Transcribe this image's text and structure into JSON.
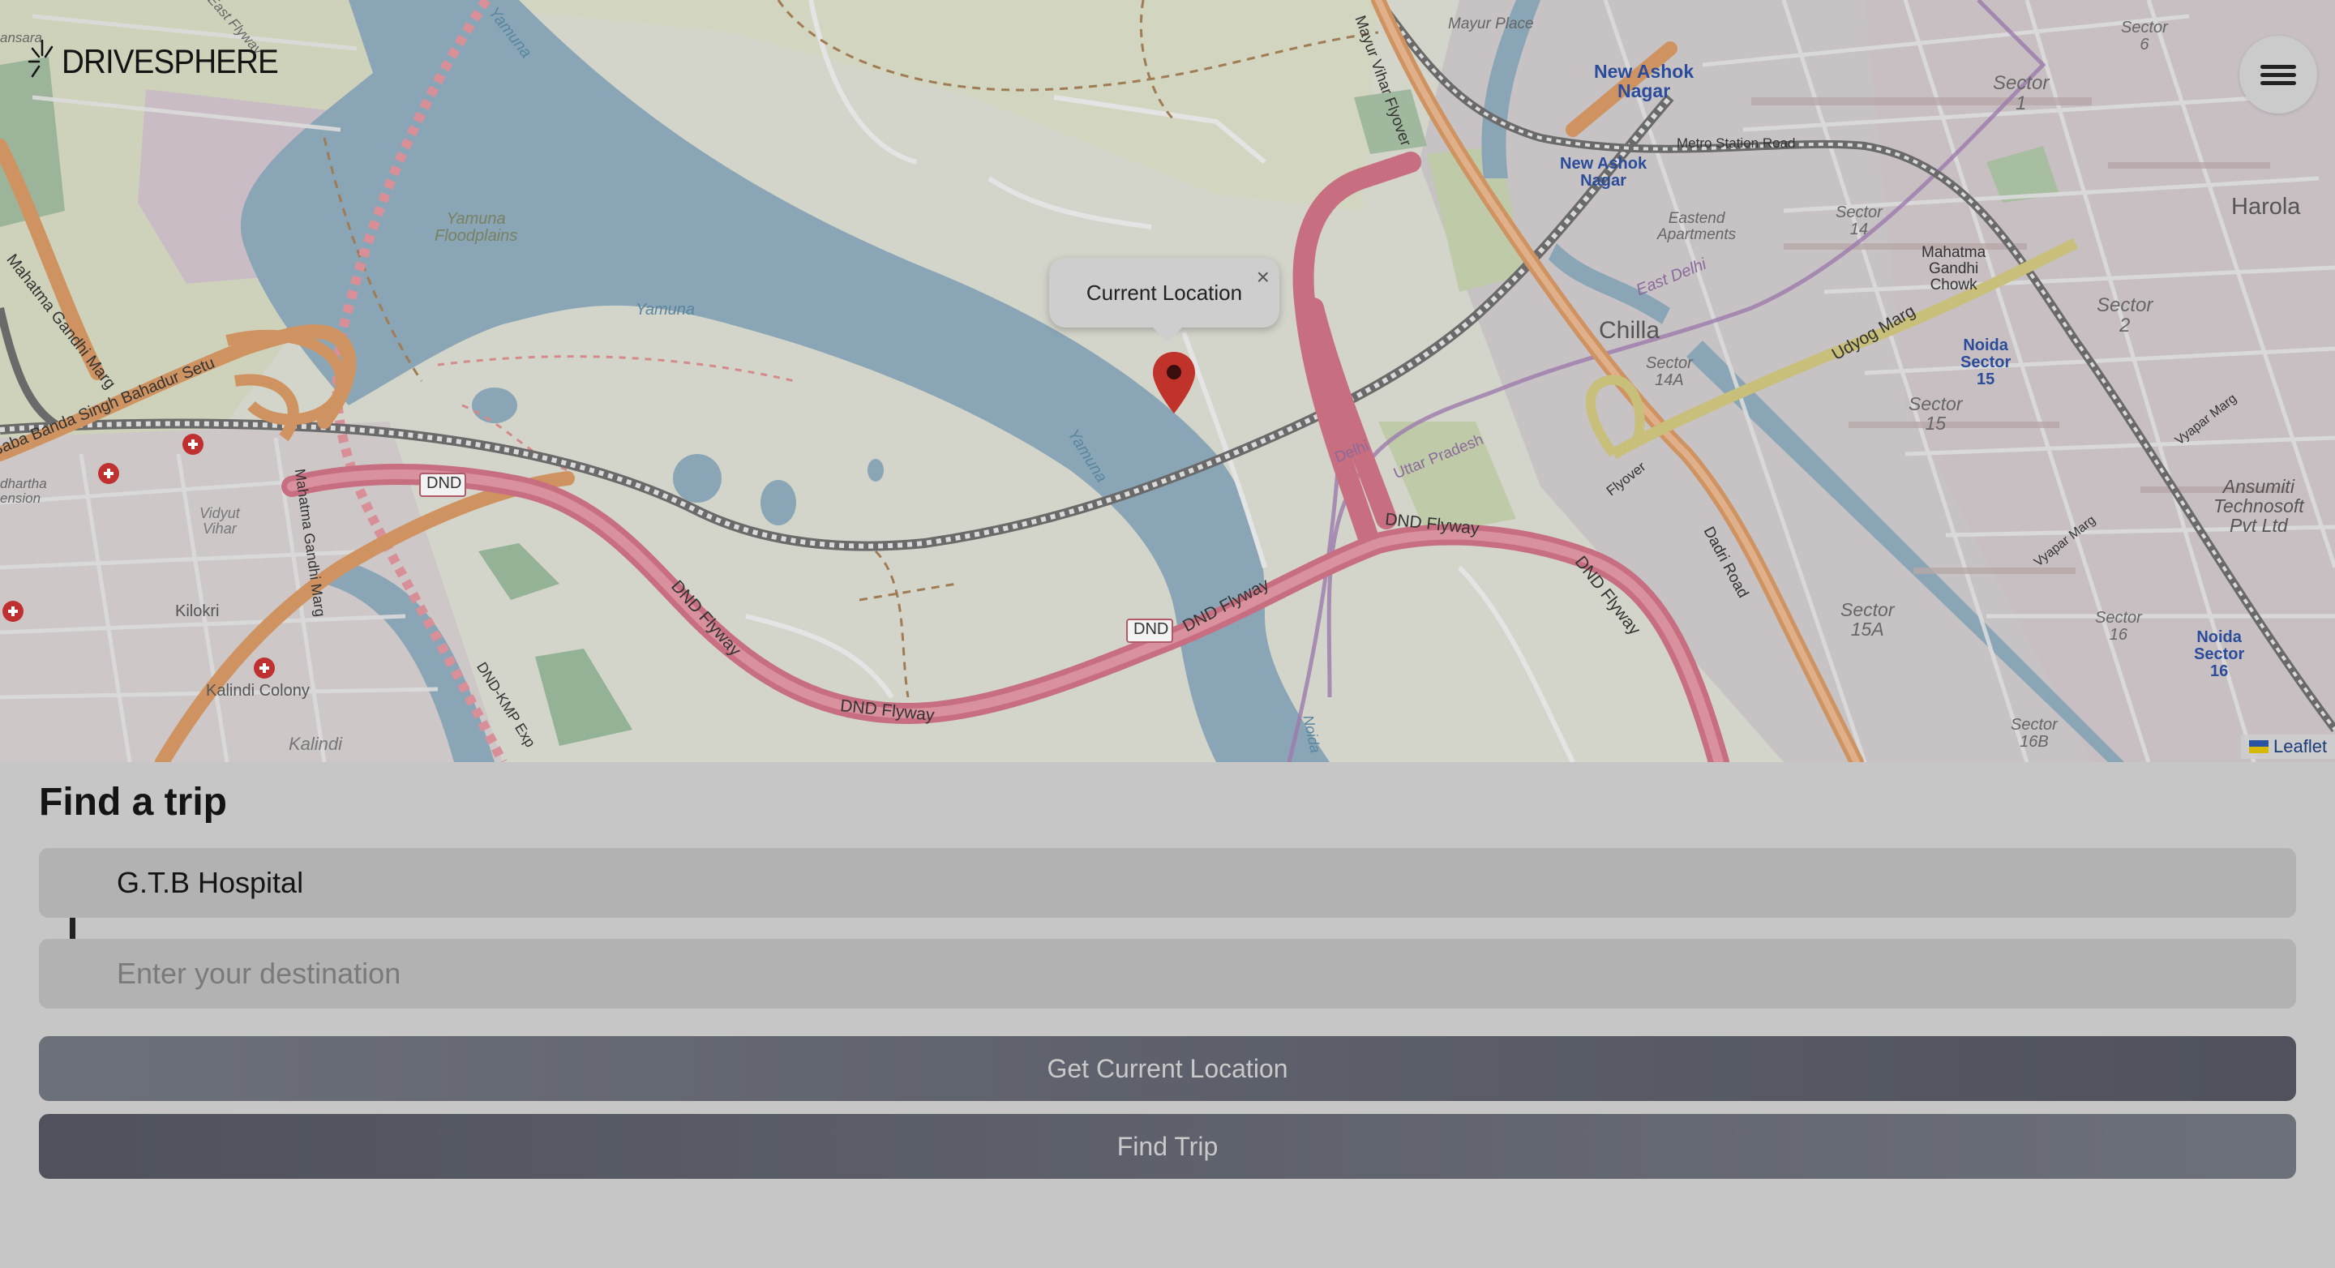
{
  "brand": {
    "logo_text": "DRIVESPHERE",
    "logo_icon": "spark-icon"
  },
  "header": {
    "menu_icon": "hamburger-menu-icon"
  },
  "map": {
    "popup": {
      "text": "Current Location",
      "close_symbol": "×"
    },
    "marker_icon": "map-pin-icon",
    "attribution": "Leaflet",
    "labels": {
      "mayur_place": "Mayur\nPlace",
      "new_ashok_nagar_1": "New Ashok\nNagar",
      "new_ashok_nagar_2": "New Ashok\nNagar",
      "metro_station_road": "Metro Station Road",
      "sector_6": "Sector\n6",
      "sector_1": "Sector\n1",
      "harola": "Harola",
      "yamuna_floodplains": "Yamuna\nFloodplains",
      "yamuna_river_1": "Yamuna",
      "yamuna_river_2": "Yamuna",
      "yamuna_river_3": "Yamuna",
      "eastend_apartments": "Eastend\nApartments",
      "sector_14": "Sector\n14",
      "mahatma_gandhi_chowk": "Mahatma\nGandhi\nChowk",
      "east_delhi": "East Delhi",
      "chilla": "Chilla",
      "sector_14a": "Sector\n14A",
      "sector_2": "Sector\n2",
      "udyog_marg": "Udyog Marg",
      "noida_sector_15": "Noida\nSector\n15",
      "sector_15": "Sector\n15",
      "vyapar_marg_1": "Vyapar Marg",
      "vyapar_marg_2": "Vyapar Marg",
      "ansumiti": "Ansumiti\nTechnosoft\nPvt Ltd",
      "mahatma_gandhi_marg": "Mahatma Gandhi Marg",
      "baba_banda_singh": "Baba Banda Singh Bahadur Setu",
      "dnd_1": "DND",
      "dnd_2": "DND",
      "dnd_flyway_1": "DND Flyway",
      "dnd_flyway_2": "DND Flyway",
      "dnd_flyway_3": "DND Flyway",
      "dnd_flyway_4": "DND Flyway",
      "dnd_flyway_5": "DND Flyway",
      "delhi": "Delhi",
      "uttar_pradesh": "Uttar Pradesh",
      "flyover": "Flyover",
      "dadri_road": "Dadri Road",
      "sector_15a": "Sector\n15A",
      "sector_16": "Sector\n16",
      "noida_sector_16": "Noida\nSector\n16",
      "sector_16b": "Sector\n16B",
      "mayur_vihar_flyover": "Mayur Vihar Flyover",
      "east_flyway": "East Flyway",
      "vidyut_vihar": "Vidyut\nVihar",
      "kilokri": "Kilokri",
      "kalindi_colony": "Kalindi Colony",
      "kalindi": "Kalindi",
      "dnd_kmp_exp": "DND-KMP Exp",
      "noida": "Noida",
      "ansara": "ansara",
      "dhartha_ension": "dhartha\nension",
      "mahatma_gandhi_marg_2": "Mahatma Gandhi Marg"
    }
  },
  "panel": {
    "title": "Find a trip",
    "pickup": {
      "value": "G.T.B Hospital",
      "placeholder": ""
    },
    "destination": {
      "value": "",
      "placeholder": "Enter your destination"
    },
    "current_location_label": "Get Current Location",
    "find_trip_label": "Find Trip"
  }
}
